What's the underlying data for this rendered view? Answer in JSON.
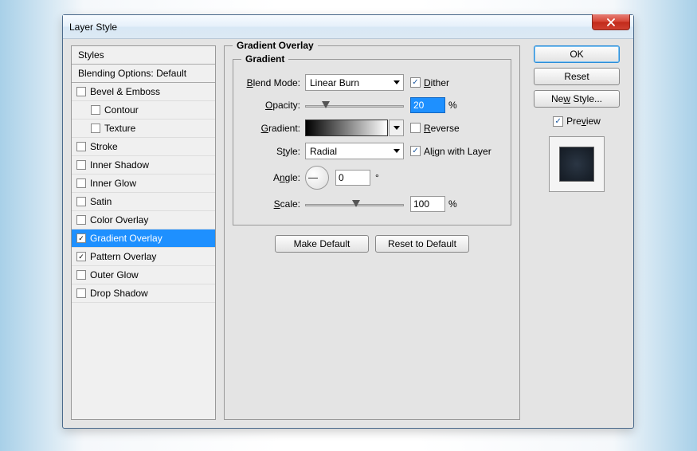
{
  "window": {
    "title": "Layer Style"
  },
  "styles": {
    "header": "Styles",
    "blending": "Blending Options: Default",
    "items": [
      {
        "label": "Bevel & Emboss",
        "checked": false,
        "indent": false
      },
      {
        "label": "Contour",
        "checked": false,
        "indent": true
      },
      {
        "label": "Texture",
        "checked": false,
        "indent": true
      },
      {
        "label": "Stroke",
        "checked": false,
        "indent": false
      },
      {
        "label": "Inner Shadow",
        "checked": false,
        "indent": false
      },
      {
        "label": "Inner Glow",
        "checked": false,
        "indent": false
      },
      {
        "label": "Satin",
        "checked": false,
        "indent": false
      },
      {
        "label": "Color Overlay",
        "checked": false,
        "indent": false
      },
      {
        "label": "Gradient Overlay",
        "checked": true,
        "indent": false,
        "selected": true
      },
      {
        "label": "Pattern Overlay",
        "checked": true,
        "indent": false
      },
      {
        "label": "Outer Glow",
        "checked": false,
        "indent": false
      },
      {
        "label": "Drop Shadow",
        "checked": false,
        "indent": false
      }
    ]
  },
  "main": {
    "section_title": "Gradient Overlay",
    "group_title": "Gradient",
    "labels": {
      "blend_mode": "Blend Mode:",
      "opacity": "Opacity:",
      "gradient": "Gradient:",
      "style": "Style:",
      "angle": "Angle:",
      "scale": "Scale:"
    },
    "blend_mode_value": "Linear Burn",
    "dither": {
      "label": "Dither",
      "checked": true
    },
    "opacity_value": "20",
    "opacity_suffix": "%",
    "reverse": {
      "label": "Reverse",
      "checked": false
    },
    "style_value": "Radial",
    "align": {
      "label": "Align with Layer",
      "checked": true
    },
    "angle_value": "0",
    "angle_suffix": "°",
    "scale_value": "100",
    "scale_suffix": "%",
    "make_default": "Make Default",
    "reset_default": "Reset to Default"
  },
  "side": {
    "ok": "OK",
    "reset": "Reset",
    "new_style": "New Style...",
    "preview": {
      "label": "Preview",
      "checked": true
    }
  }
}
